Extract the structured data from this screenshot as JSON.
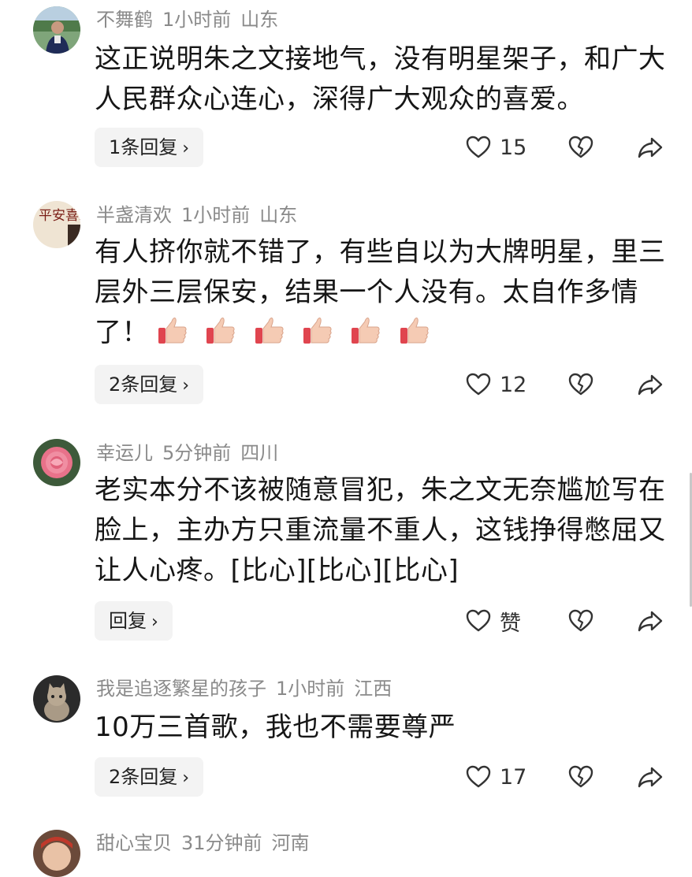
{
  "comments": [
    {
      "user": "不舞鹤",
      "time": "1小时前",
      "location": "山东",
      "text": "这正说明朱之文接地气，没有明星架子，和广大人民群众心连心，深得广大观众的喜爱。",
      "replies": "1条回复",
      "likes": "15",
      "avatar": "man-outdoors"
    },
    {
      "user": "半盏清欢",
      "time": "1小时前",
      "location": "山东",
      "text": "有人挤你就不错了，有些自以为大牌明星，里三层外三层保安，结果一个人没有。太自作多情了！",
      "replies": "2条回复",
      "likes": "12",
      "avatar": "calligraphy-ping-an-xi-le",
      "avatar_text": "平安喜乐",
      "emoji": "thumbs-up",
      "emoji_count": 6
    },
    {
      "user": "幸运儿",
      "time": "5分钟前",
      "location": "四川",
      "text": "老实本分不该被随意冒犯，朱之文无奈尴尬写在脸上，主办方只重流量不重人，这钱挣得憋屈又让人心疼。[比心][比心][比心]",
      "replies": "回复",
      "likes": "赞",
      "avatar": "pink-rose"
    },
    {
      "user": "我是追逐繁星的孩子",
      "time": "1小时前",
      "location": "江西",
      "text": "10万三首歌，我也不需要尊严",
      "replies": "2条回复",
      "likes": "17",
      "avatar": "kitten"
    },
    {
      "user": "甜心宝贝",
      "time": "31分钟前",
      "location": "河南",
      "avatar": "child-portrait"
    }
  ],
  "icons": {
    "like": "heart-outline-icon",
    "dislike": "broken-heart-icon",
    "share": "share-arrow-icon",
    "chevron": "chevron-right-icon"
  },
  "colors": {
    "meta": "#8a8a8a",
    "text": "#161616",
    "reply_bg": "#f3f3f3",
    "emoji_skin": "#f5cbb4",
    "emoji_cuff": "#e0454f"
  }
}
